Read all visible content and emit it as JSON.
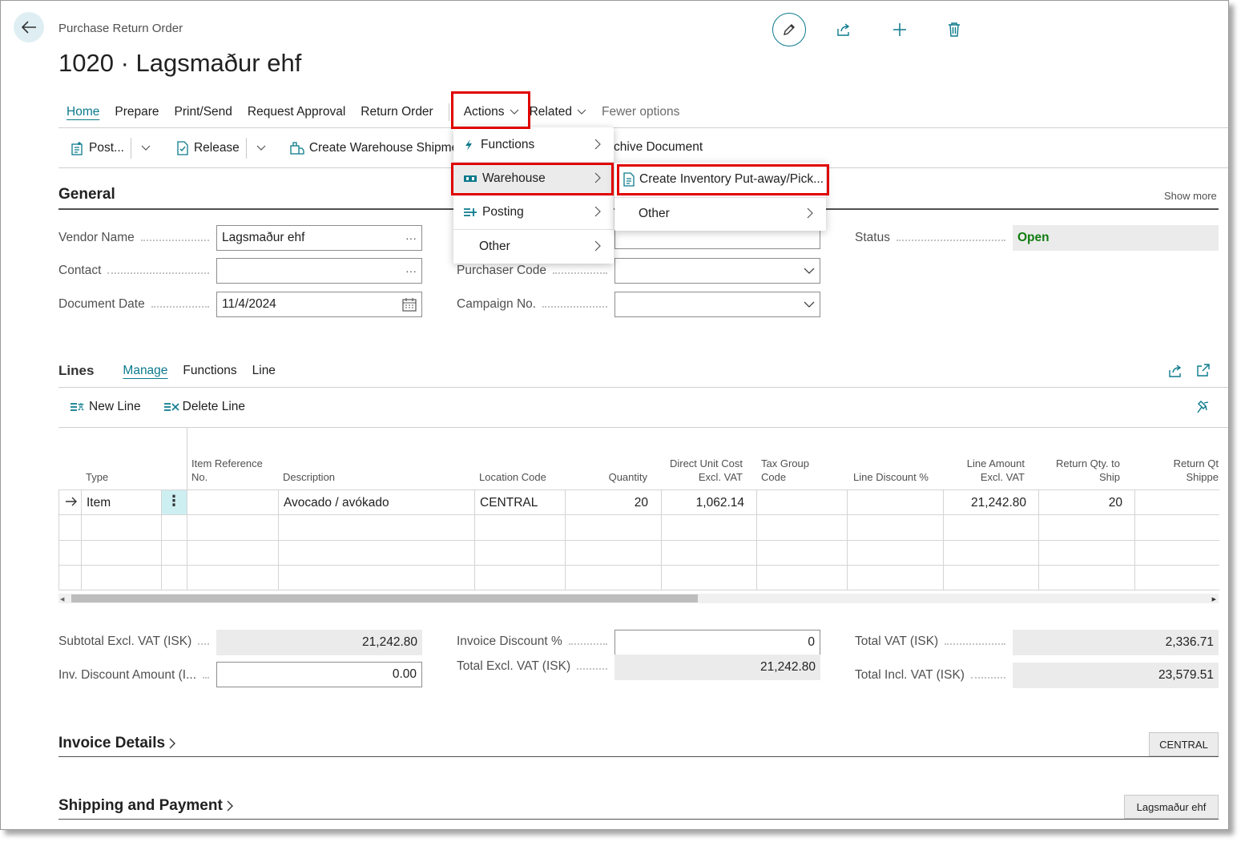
{
  "header": {
    "caption": "Purchase Return Order",
    "title": "1020 · Lagsmaður ehf"
  },
  "tabs": {
    "home": "Home",
    "prepare": "Prepare",
    "print_send": "Print/Send",
    "request_approval": "Request Approval",
    "return_order": "Return Order",
    "actions": "Actions",
    "related": "Related",
    "fewer_options": "Fewer options"
  },
  "toolbar": {
    "post": "Post...",
    "release": "Release",
    "create_shipment": "Create Warehouse Shipment",
    "archive_partial": "chive Document"
  },
  "actions_menu": {
    "items": [
      "Functions",
      "Warehouse",
      "Posting",
      "Other"
    ]
  },
  "warehouse_submenu": {
    "items": [
      "Create Inventory Put-away/Pick...",
      "Other"
    ]
  },
  "general": {
    "title": "General",
    "show_more": "Show more",
    "vendor_name_label": "Vendor Name",
    "vendor_name_value": "Lagsmaður ehf",
    "contact_label": "Contact",
    "contact_value": "",
    "document_date_label": "Document Date",
    "document_date_value": "11/4/2024",
    "purchaser_code_label": "Purchaser Code",
    "campaign_no_label": "Campaign No.",
    "status_label": "Status",
    "status_value": "Open"
  },
  "lines": {
    "title": "Lines",
    "tabs": [
      "Manage",
      "Functions",
      "Line"
    ],
    "new_line": "New Line",
    "delete_line": "Delete Line",
    "columns": {
      "type": "Type",
      "item_ref_1": "Item Reference",
      "item_ref_2": "No.",
      "description": "Description",
      "location_code": "Location Code",
      "quantity": "Quantity",
      "direct_cost_1": "Direct Unit Cost",
      "direct_cost_2": "Excl. VAT",
      "tax_group_1": "Tax Group",
      "tax_group_2": "Code",
      "line_discount": "Line Discount %",
      "line_amount_1": "Line Amount",
      "line_amount_2": "Excl. VAT",
      "return_qty_1": "Return Qty. to",
      "return_qty_2": "Ship",
      "return_shipped_1": "Return Qt",
      "return_shipped_2": "Shippe"
    },
    "rows": [
      {
        "type": "Item",
        "description": "Avocado / avókado",
        "location_code": "CENTRAL",
        "quantity": "20",
        "direct_unit_cost": "1,062.14",
        "line_amount": "21,242.80",
        "return_qty_to_ship": "20"
      }
    ]
  },
  "totals": {
    "subtotal_label": "Subtotal Excl. VAT (ISK)",
    "subtotal_value": "21,242.80",
    "inv_discount_amount_label": "Inv. Discount Amount (I...",
    "inv_discount_amount_value": "0.00",
    "invoice_discount_pct_label": "Invoice Discount %",
    "invoice_discount_pct_value": "0",
    "total_excl_vat_label": "Total Excl. VAT (ISK)",
    "total_excl_vat_value": "21,242.80",
    "total_vat_label": "Total VAT (ISK)",
    "total_vat_value": "2,336.71",
    "total_incl_vat_label": "Total Incl. VAT (ISK)",
    "total_incl_vat_value": "23,579.51"
  },
  "invoice_details": {
    "title": "Invoice Details",
    "badge": "CENTRAL"
  },
  "shipping_payment": {
    "title": "Shipping and Payment",
    "badge": "Lagsmaður ehf"
  },
  "colors": {
    "accent": "#0b7a8c",
    "highlight": "#e00000",
    "status_open": "#107c10",
    "readonly_bg": "#ebebeb"
  }
}
